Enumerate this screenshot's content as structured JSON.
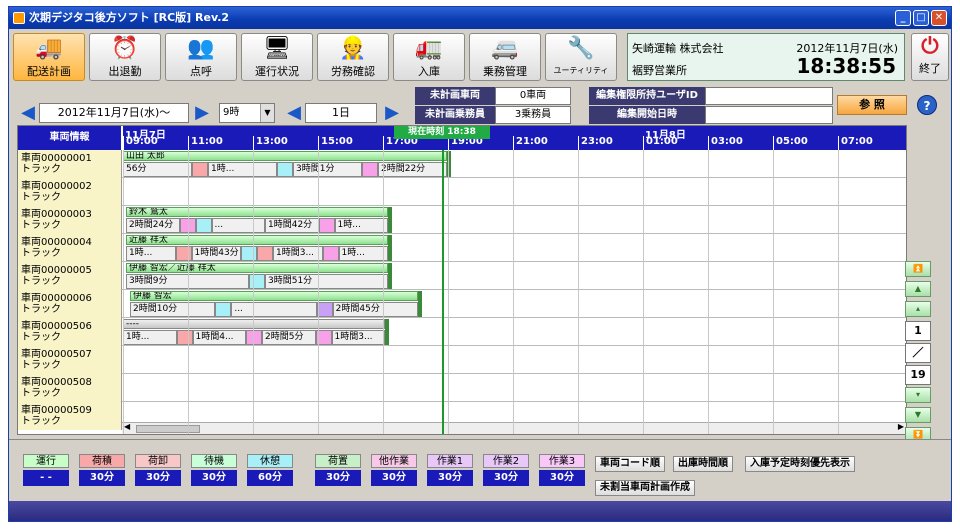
{
  "window": {
    "title": "次期デジタコ後方ソフト [RC版] Rev.2"
  },
  "toolbar": [
    {
      "id": "plan",
      "label": "配送計画",
      "icon": "truck-plan-icon",
      "glyph": "🚚",
      "active": true
    },
    {
      "id": "attendance",
      "label": "出退勤",
      "icon": "clock-icon",
      "glyph": "⏰",
      "active": false
    },
    {
      "id": "rollcall",
      "label": "点呼",
      "icon": "people-icon",
      "glyph": "👥",
      "active": false
    },
    {
      "id": "status",
      "label": "運行状況",
      "icon": "monitor-icon",
      "glyph": "🖥",
      "active": false
    },
    {
      "id": "labor",
      "label": "労務確認",
      "icon": "worker-icon",
      "glyph": "👷",
      "active": false
    },
    {
      "id": "inbound",
      "label": "入庫",
      "icon": "truck-inbound-icon",
      "glyph": "🚛",
      "active": false
    },
    {
      "id": "crew",
      "label": "乗務管理",
      "icon": "crew-icon",
      "glyph": "🚐",
      "active": false
    },
    {
      "id": "utility",
      "label": "ユーティリティ",
      "icon": "tools-icon",
      "glyph": "🔧",
      "active": false
    }
  ],
  "company": {
    "name": "矢崎運輸 株式会社",
    "office": "裾野営業所",
    "date": "2012年11月7日(水)",
    "time": "18:38:55"
  },
  "exit": {
    "label": "終了"
  },
  "nav": {
    "date": "2012年11月7日(水)～",
    "hour": "9時",
    "span": "1日",
    "prev": "<",
    "next": ">"
  },
  "info": {
    "unplanned_vehicles_label": "未計画車両",
    "unplanned_vehicles": "0車両",
    "unplanned_crew_label": "未計画乗務員",
    "unplanned_crew": "3乗務員",
    "edit_user_label": "編集権限所持ユーザID",
    "edit_user": "",
    "edit_start_label": "編集開始日時",
    "edit_start": ""
  },
  "ref_button": "参 照",
  "help_button": "?",
  "grid": {
    "vehicle_header": "車両情報",
    "now_badge": "現在時刻 18:38",
    "day1": "11月7日",
    "day2": "11月8日",
    "hours": [
      "09:00",
      "11:00",
      "13:00",
      "15:00",
      "17:00",
      "19:00",
      "21:00",
      "23:00",
      "01:00",
      "03:00",
      "05:00",
      "07:00"
    ],
    "rows": [
      {
        "vehicle": "車両00000001",
        "type": "トラック",
        "driver": "山田 太郎",
        "segs": [
          [
            "56分",
            ""
          ],
          [
            "",
            "pink"
          ],
          [
            "1時...",
            ""
          ],
          [
            "",
            "cyan"
          ],
          [
            "3時間1分",
            ""
          ],
          [
            "",
            "mag"
          ],
          [
            "2時間22分",
            ""
          ]
        ]
      },
      {
        "vehicle": "車両00000002",
        "type": "トラック",
        "driver": null,
        "segs": []
      },
      {
        "vehicle": "車両00000003",
        "type": "トラック",
        "driver": "鈴木 鷲太",
        "segs": [
          [
            "2時間24分",
            ""
          ],
          [
            "",
            "mag"
          ],
          [
            "",
            "cyan"
          ],
          [
            "...",
            ""
          ],
          [
            "1時間42分",
            ""
          ],
          [
            "",
            "mag"
          ],
          [
            "1時...",
            ""
          ]
        ]
      },
      {
        "vehicle": "車両00000004",
        "type": "トラック",
        "driver": "近藤 祥太",
        "segs": [
          [
            "1時...",
            ""
          ],
          [
            "",
            "pink"
          ],
          [
            "1時間43分",
            ""
          ],
          [
            "",
            "cyan"
          ],
          [
            "",
            "pink"
          ],
          [
            "1時間3...",
            ""
          ],
          [
            "",
            "mag"
          ],
          [
            "1時...",
            ""
          ]
        ]
      },
      {
        "vehicle": "車両00000005",
        "type": "トラック",
        "driver": "伊藤 智宏／近藤 祥太",
        "segs": [
          [
            "3時間9分",
            ""
          ],
          [
            "",
            "cyan"
          ],
          [
            "3時間51分",
            ""
          ]
        ]
      },
      {
        "vehicle": "車両00000006",
        "type": "トラック",
        "driver": "伊藤 智宏",
        "segs": [
          [
            "2時間10分",
            ""
          ],
          [
            "",
            "cyan"
          ],
          [
            "...",
            ""
          ],
          [
            "",
            "purple"
          ],
          [
            "2時間45分",
            ""
          ]
        ]
      },
      {
        "vehicle": "車両00000506",
        "type": "トラック",
        "driver": "----",
        "segs": [
          [
            "1時...",
            ""
          ],
          [
            "",
            "pink"
          ],
          [
            "1時間4...",
            ""
          ],
          [
            "",
            "mag"
          ],
          [
            "2時間5分",
            ""
          ],
          [
            "",
            "mag"
          ],
          [
            "1時間3...",
            ""
          ]
        ]
      },
      {
        "vehicle": "車両00000507",
        "type": "トラック",
        "driver": null,
        "segs": []
      },
      {
        "vehicle": "車両00000508",
        "type": "トラック",
        "driver": null,
        "segs": []
      },
      {
        "vehicle": "車両00000509",
        "type": "トラック",
        "driver": null,
        "segs": []
      }
    ]
  },
  "pager": {
    "current": "1",
    "sep": "／",
    "total": "19"
  },
  "legend": [
    {
      "name": "運行",
      "value": "- -",
      "color": "#c8ffc8"
    },
    {
      "name": "荷積",
      "value": "30分",
      "color": "#f8a8a8"
    },
    {
      "name": "荷卸",
      "value": "30分",
      "color": "#f8c8c8"
    },
    {
      "name": "待機",
      "value": "30分",
      "color": "#c8ffd8"
    },
    {
      "name": "休憩",
      "value": "60分",
      "color": "#a8f0f8"
    },
    {
      "name": "荷置",
      "value": "30分",
      "color": "#c8f0c8"
    },
    {
      "name": "他作業",
      "value": "30分",
      "color": "#f8c8e8"
    },
    {
      "name": "作業1",
      "value": "30分",
      "color": "#e8c8f8"
    },
    {
      "name": "作業2",
      "value": "30分",
      "color": "#e8c8f8"
    },
    {
      "name": "作業3",
      "value": "30分",
      "color": "#f8c8f8"
    }
  ],
  "sort": {
    "vehicle_code": "車両コード順",
    "depart_time": "出庫時間順",
    "inbound_priority": "入庫予定時刻優先表示",
    "create_unassigned": "未割当車両計画作成"
  }
}
